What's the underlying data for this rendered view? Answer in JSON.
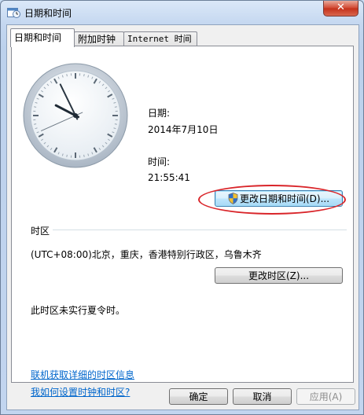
{
  "window": {
    "title": "日期和时间",
    "close_glyph": "✕"
  },
  "tabs": [
    {
      "label": "日期和时间"
    },
    {
      "label": "附加时钟"
    },
    {
      "label": "Internet 时间"
    }
  ],
  "datetime": {
    "date_label": "日期:",
    "date_value": "2014年7月10日",
    "time_label": "时间:",
    "time_value": "21:55:41",
    "change_button": "更改日期和时间(D)..."
  },
  "clock": {
    "hour": 21,
    "minute": 55,
    "second": 41
  },
  "timezone": {
    "section_label": "时区",
    "value": "(UTC+08:00)北京，重庆，香港特别行政区，乌鲁木齐",
    "change_button": "更改时区(Z)...",
    "dst_note": "此时区未实行夏令时。"
  },
  "links": {
    "online_info": "联机获取详细的时区信息",
    "howto": "我如何设置时钟和时区?"
  },
  "footer": {
    "ok": "确定",
    "cancel": "取消",
    "apply": "应用(A)"
  },
  "colors": {
    "accent_ring": "#d9252a",
    "link": "#0066cc"
  }
}
